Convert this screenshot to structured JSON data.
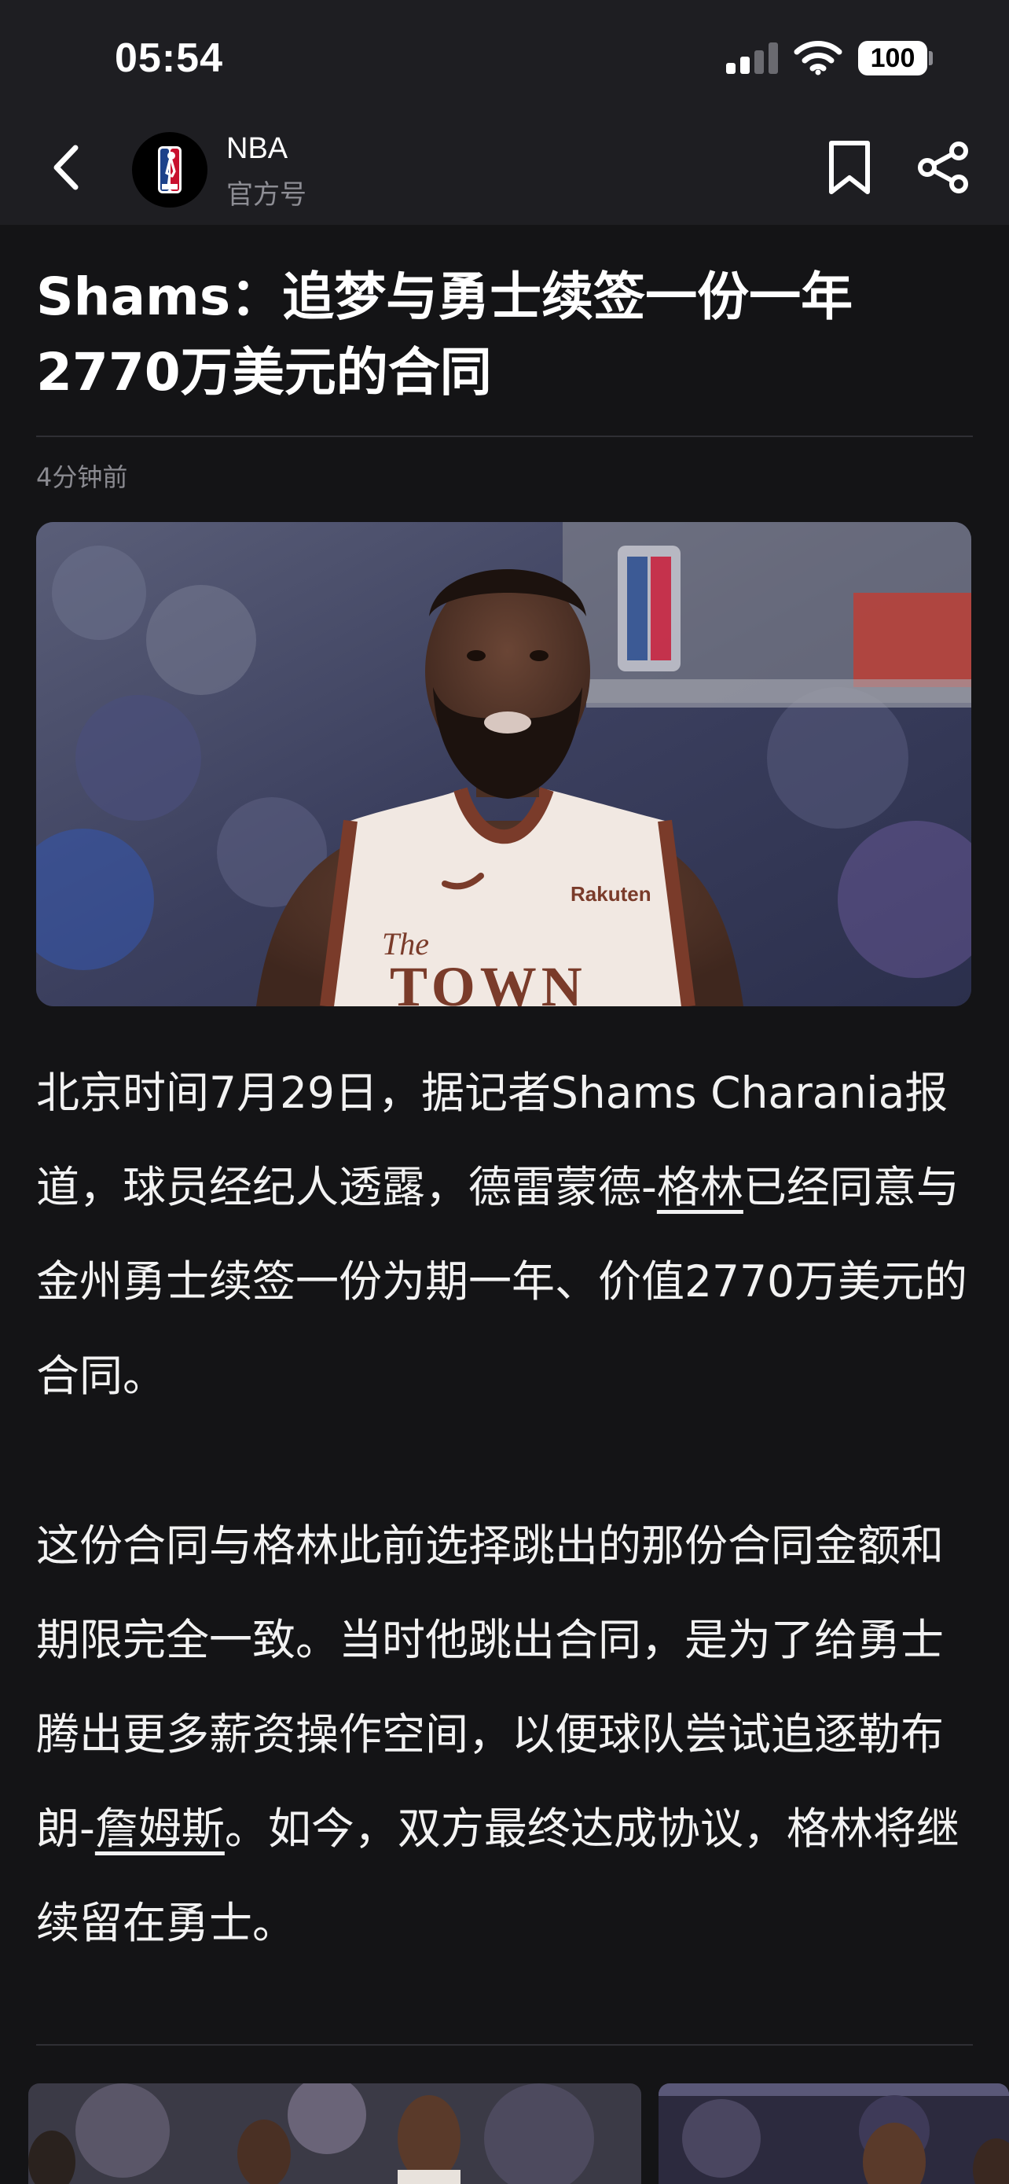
{
  "status": {
    "time": "05:54",
    "battery": "100"
  },
  "nav": {
    "channel_name": "NBA",
    "channel_subtitle": "官方号"
  },
  "article": {
    "title": "Shams：追梦与勇士续签一份一年2770万美元的合同",
    "time_ago": "4分钟前",
    "image_text": {
      "jersey_line1": "The",
      "jersey_line2": "TOWN",
      "sponsor": "Rakuten"
    },
    "paragraph1": {
      "before_link": "北京时间7月29日，据记者Shams Charania报道，球员经纪人透露，德雷蒙德-",
      "link": "格林",
      "after_link": "已经同意与金州勇士续签一份为期一年、价值2770万美元的合同。"
    },
    "paragraph2": {
      "before_link": "这份合同与格林此前选择跳出的那份合同金额和期限完全一致。当时他跳出合同，是为了给勇士腾出更多薪资操作空间，以便球队尝试追逐勒布朗-",
      "link": "詹姆斯",
      "after_link": "。如今，双方最终达成协议，格林将继续留在勇士。"
    }
  },
  "colors": {
    "page_background": "#141416",
    "header_background": "#1e1e22",
    "primary_text": "#ffffff",
    "secondary_text": "#8a8a90"
  },
  "icons": [
    "back-icon",
    "nba-logo",
    "bookmark-icon",
    "share-icon",
    "signal-icon",
    "wifi-icon",
    "battery-icon"
  ]
}
